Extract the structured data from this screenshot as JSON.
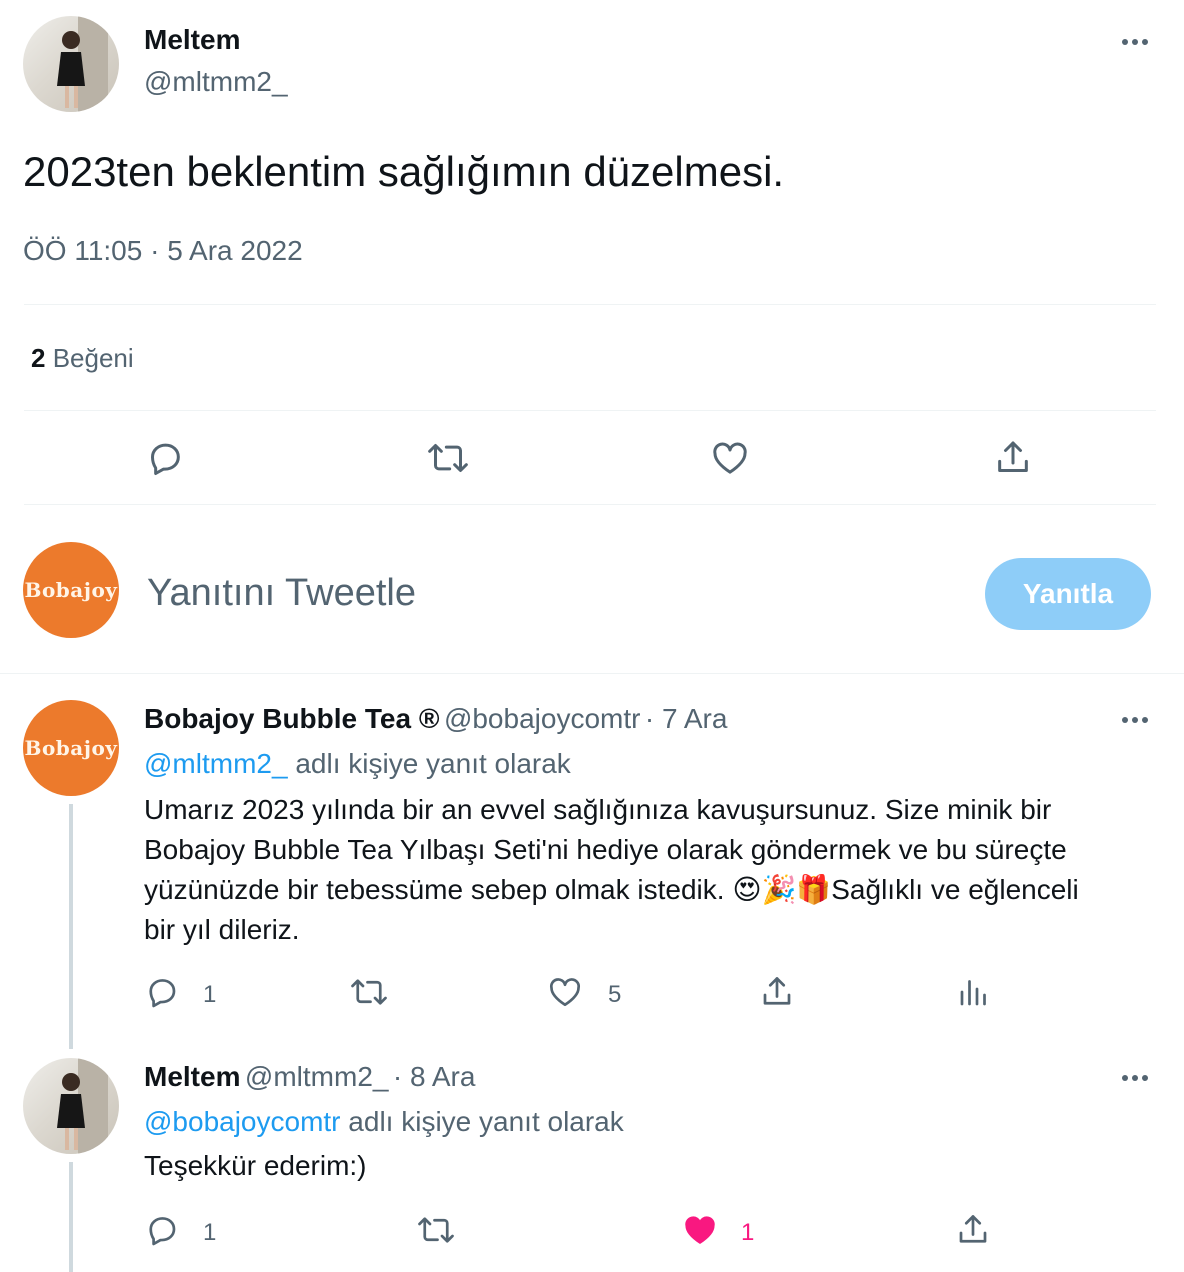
{
  "main_tweet": {
    "author_name": "Meltem",
    "author_handle": "@mltmm2_",
    "text": "2023ten beklentim sağlığımın düzelmesi.",
    "timestamp": "ÖÖ 11:05 · 5 Ara 2022",
    "likes_count": "2",
    "likes_label": "Beğeni",
    "actions": [
      "reply-icon",
      "retweet-icon",
      "like-icon",
      "share-icon"
    ]
  },
  "compose": {
    "avatar_text": "Bobajoy",
    "placeholder": "Yanıtını Tweetle",
    "button_label": "Yanıtla"
  },
  "replies": [
    {
      "avatar_text": "Bobajoy",
      "author_name": "Bobajoy Bubble Tea ®",
      "author_handle": "@bobajoycomtr",
      "date": "· 7 Ara",
      "reply_to_handle": "@mltmm2_",
      "reply_to_suffix": "adlı kişiye yanıt olarak",
      "text_lines": [
        "Umarız 2023 yılında bir an evvel sağlığınıza kavuşursunuz. Size minik bir",
        "Bobajoy Bubble Tea Yılbaşı Seti'ni hediye olarak göndermek ve bu süreçte",
        "yüzünüzde bir tebessüme sebep olmak istedik. ",
        "bir yıl dileriz."
      ],
      "emojis": "😍🎉🎁",
      "text_after_emojis": "Sağlıklı ve eğlenceli",
      "reply_count": "1",
      "like_count": "5"
    },
    {
      "author_name": "Meltem",
      "author_handle": "@mltmm2_",
      "date": "· 8 Ara",
      "reply_to_handle": "@bobajoycomtr",
      "reply_to_suffix": "adlı kişiye yanıt olarak",
      "text": "Teşekkür ederim:)",
      "reply_count": "1",
      "like_count": "1",
      "liked": true
    }
  ],
  "colors": {
    "accent": "#1d9bf0",
    "like_active": "#f91880",
    "brand_orange": "#ec7a2c",
    "reply_button": "#8ecdf8"
  }
}
